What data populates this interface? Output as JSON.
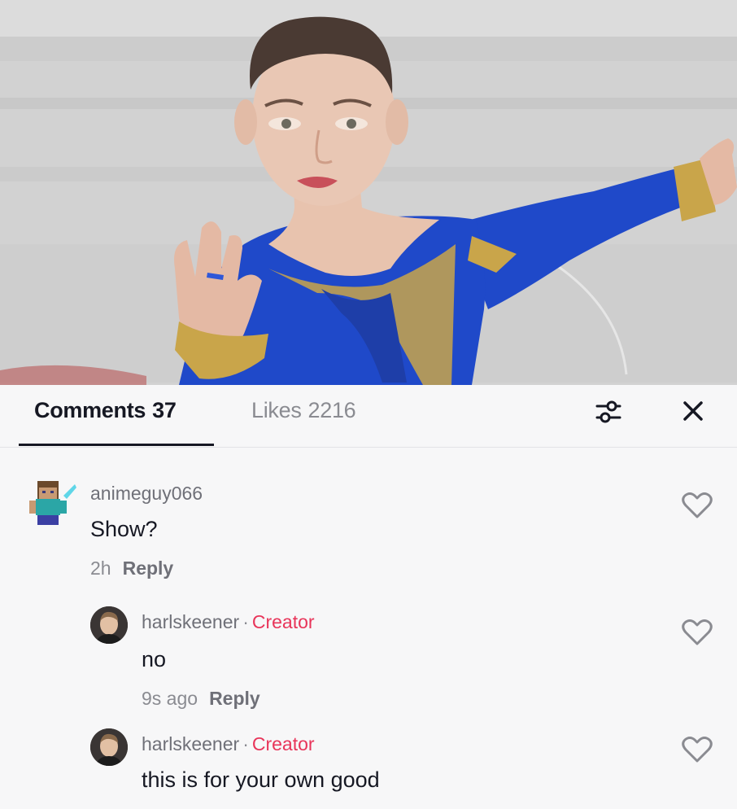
{
  "tabs": {
    "comments_label": "Comments",
    "comments_count": "37",
    "likes_label": "Likes",
    "likes_count": "2216"
  },
  "icons": {
    "filter": "filter-sliders-icon",
    "close": "close-icon",
    "like": "heart-outline-icon"
  },
  "colors": {
    "creator": "#e8355a",
    "costume": "#1f49c9",
    "trim": "#c9a54a"
  },
  "comments": [
    {
      "username": "animeguy066",
      "text": "Show?",
      "time": "2h",
      "reply_label": "Reply"
    },
    {
      "username": "harlskeener",
      "badge": "Creator",
      "separator": "·",
      "text": "no",
      "time": "9s ago",
      "reply_label": "Reply"
    },
    {
      "username": "harlskeener",
      "badge": "Creator",
      "separator": "·",
      "text": "this is for your own good"
    }
  ]
}
